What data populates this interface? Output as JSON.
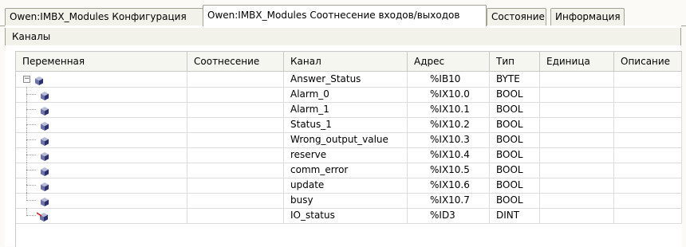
{
  "tabs": [
    {
      "label": "Owen:IMBX_Modules Конфигурация",
      "active": false
    },
    {
      "label": "Owen:IMBX_Modules Соотнесение входов/выходов",
      "active": true
    },
    {
      "label": "Состояние",
      "active": false
    },
    {
      "label": "Информация",
      "active": false
    }
  ],
  "section_label": "Каналы",
  "columns": [
    "Переменная",
    "Соотнесение",
    "Канал",
    "Адрес",
    "Тип",
    "Единица",
    "Описание"
  ],
  "rows": [
    {
      "variable": "",
      "mapping": "",
      "channel": "Answer_Status",
      "address": "%IB10",
      "type": "BYTE",
      "unit": "",
      "description": "",
      "icon": "variable-cube-icon",
      "expanded": true
    },
    {
      "variable": "",
      "mapping": "",
      "channel": "Alarm_0",
      "address": "%IX10.0",
      "type": "BOOL",
      "unit": "",
      "description": "",
      "icon": "variable-cube-icon"
    },
    {
      "variable": "",
      "mapping": "",
      "channel": "Alarm_1",
      "address": "%IX10.1",
      "type": "BOOL",
      "unit": "",
      "description": "",
      "icon": "variable-cube-icon"
    },
    {
      "variable": "",
      "mapping": "",
      "channel": "Status_1",
      "address": "%IX10.2",
      "type": "BOOL",
      "unit": "",
      "description": "",
      "icon": "variable-cube-icon"
    },
    {
      "variable": "",
      "mapping": "",
      "channel": "Wrong_output_value",
      "address": "%IX10.3",
      "type": "BOOL",
      "unit": "",
      "description": "",
      "icon": "variable-cube-icon"
    },
    {
      "variable": "",
      "mapping": "",
      "channel": "reserve",
      "address": "%IX10.4",
      "type": "BOOL",
      "unit": "",
      "description": "",
      "icon": "variable-cube-icon"
    },
    {
      "variable": "",
      "mapping": "",
      "channel": "comm_error",
      "address": "%IX10.5",
      "type": "BOOL",
      "unit": "",
      "description": "",
      "icon": "variable-cube-icon"
    },
    {
      "variable": "",
      "mapping": "",
      "channel": "update",
      "address": "%IX10.6",
      "type": "BOOL",
      "unit": "",
      "description": "",
      "icon": "variable-cube-icon"
    },
    {
      "variable": "",
      "mapping": "",
      "channel": "busy",
      "address": "%IX10.7",
      "type": "BOOL",
      "unit": "",
      "description": "",
      "icon": "variable-cube-icon"
    },
    {
      "variable": "",
      "mapping": "",
      "channel": "IO_status",
      "address": "%ID3",
      "type": "DINT",
      "unit": "",
      "description": "",
      "icon": "mapped-variable-icon"
    }
  ]
}
